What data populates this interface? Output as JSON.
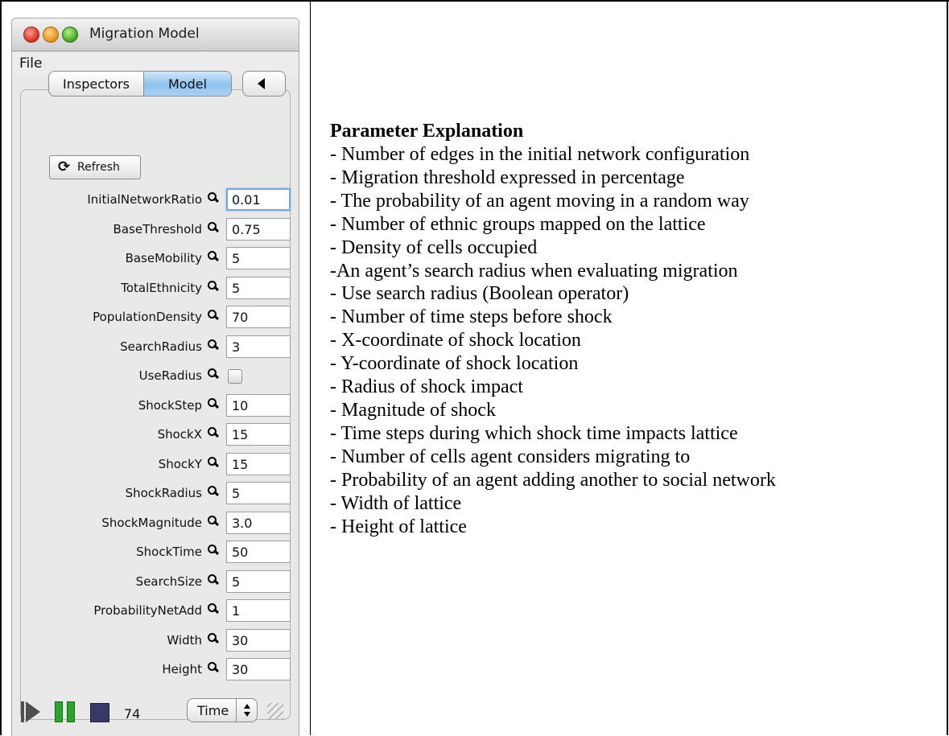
{
  "window": {
    "title": "Migration Model",
    "menu": [
      "File"
    ]
  },
  "tabs": [
    {
      "label": "Inspectors",
      "selected": false
    },
    {
      "label": "Model",
      "selected": true
    }
  ],
  "toolbar": {
    "refresh_label": "Refresh"
  },
  "params": [
    {
      "label": "InitialNetworkRatio",
      "value": "0.01"
    },
    {
      "label": "BaseThreshold",
      "value": "0.75"
    },
    {
      "label": "BaseMobility",
      "value": "5"
    },
    {
      "label": "TotalEthnicity",
      "value": "5"
    },
    {
      "label": "PopulationDensity",
      "value": "70"
    },
    {
      "label": "SearchRadius",
      "value": "3"
    },
    {
      "label": "UseRadius",
      "value": ""
    },
    {
      "label": "ShockStep",
      "value": "10"
    },
    {
      "label": "ShockX",
      "value": "15"
    },
    {
      "label": "ShockY",
      "value": "15"
    },
    {
      "label": "ShockRadius",
      "value": "5"
    },
    {
      "label": "ShockMagnitude",
      "value": "3.0"
    },
    {
      "label": "ShockTime",
      "value": "50"
    },
    {
      "label": "SearchSize",
      "value": "5"
    },
    {
      "label": "ProbabilityNetAdd",
      "value": "1"
    },
    {
      "label": "Width",
      "value": "30"
    },
    {
      "label": "Height",
      "value": "30"
    }
  ],
  "controls": {
    "step_count": "74",
    "time_select": "Time"
  },
  "explanation": {
    "heading": "Parameter Explanation",
    "lines": [
      "- Number of edges in the initial network configuration",
      "- Migration threshold expressed in percentage",
      "- The probability of an agent moving in a random way",
      "- Number of ethnic groups mapped on the lattice",
      "- Density of cells occupied",
      "-An agent’s search radius when evaluating migration",
      "- Use search radius (Boolean operator)",
      "- Number of time steps before shock",
      "- X-coordinate of shock location",
      "- Y-coordinate of shock location",
      "- Radius of shock impact",
      "- Magnitude of shock",
      "- Time steps during which shock time impacts lattice",
      "- Number of cells agent considers migrating to",
      "- Probability of an agent adding another to social network",
      "- Width of lattice",
      "- Height of lattice"
    ]
  }
}
